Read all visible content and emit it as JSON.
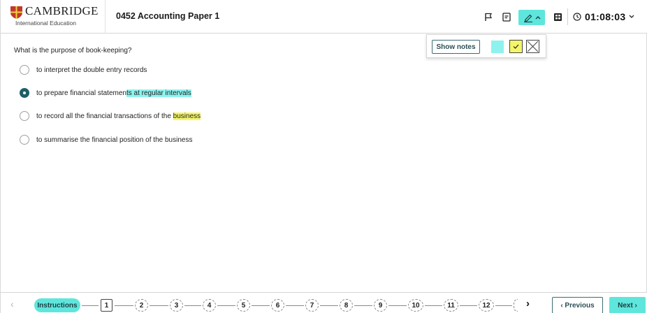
{
  "header": {
    "logo_name": "CAMBRIDGE",
    "logo_sub": "International Education",
    "paper_title": "0452 Accounting Paper 1",
    "timer": "01:08:03",
    "icons": [
      "flag-icon",
      "notes-icon",
      "highlighter-icon",
      "calculator-icon",
      "clock-icon",
      "chevron-down-icon"
    ]
  },
  "highlight_menu": {
    "show_notes_label": "Show notes",
    "colors": {
      "cyan": "#8ef3ef",
      "yellow": "#f5f56a",
      "accent": "#5fe6dc"
    }
  },
  "question": {
    "prompt": "What is the purpose of book-keeping?",
    "selected_index": 1,
    "options": [
      {
        "plain": "to interpret the double entry records",
        "highlight": "",
        "highlight_color": ""
      },
      {
        "plain": "to prepare financial statemen",
        "highlight": "ts at regular intervals",
        "highlight_color": "cyan"
      },
      {
        "plain": "to record all the financial transactions of the ",
        "highlight": "business",
        "highlight_color": "yellow"
      },
      {
        "plain": "to summarise the financial position of the business",
        "highlight": "",
        "highlight_color": ""
      }
    ]
  },
  "footer": {
    "prev_arrow": "‹",
    "instructions_label": "Instructions",
    "question_numbers": [
      "1",
      "2",
      "3",
      "4",
      "5",
      "6",
      "7",
      "8",
      "9",
      "10",
      "11",
      "12"
    ],
    "current_question": "1",
    "next_arrow": "›",
    "previous_label": "‹ Previous",
    "next_label": "Next ›"
  }
}
